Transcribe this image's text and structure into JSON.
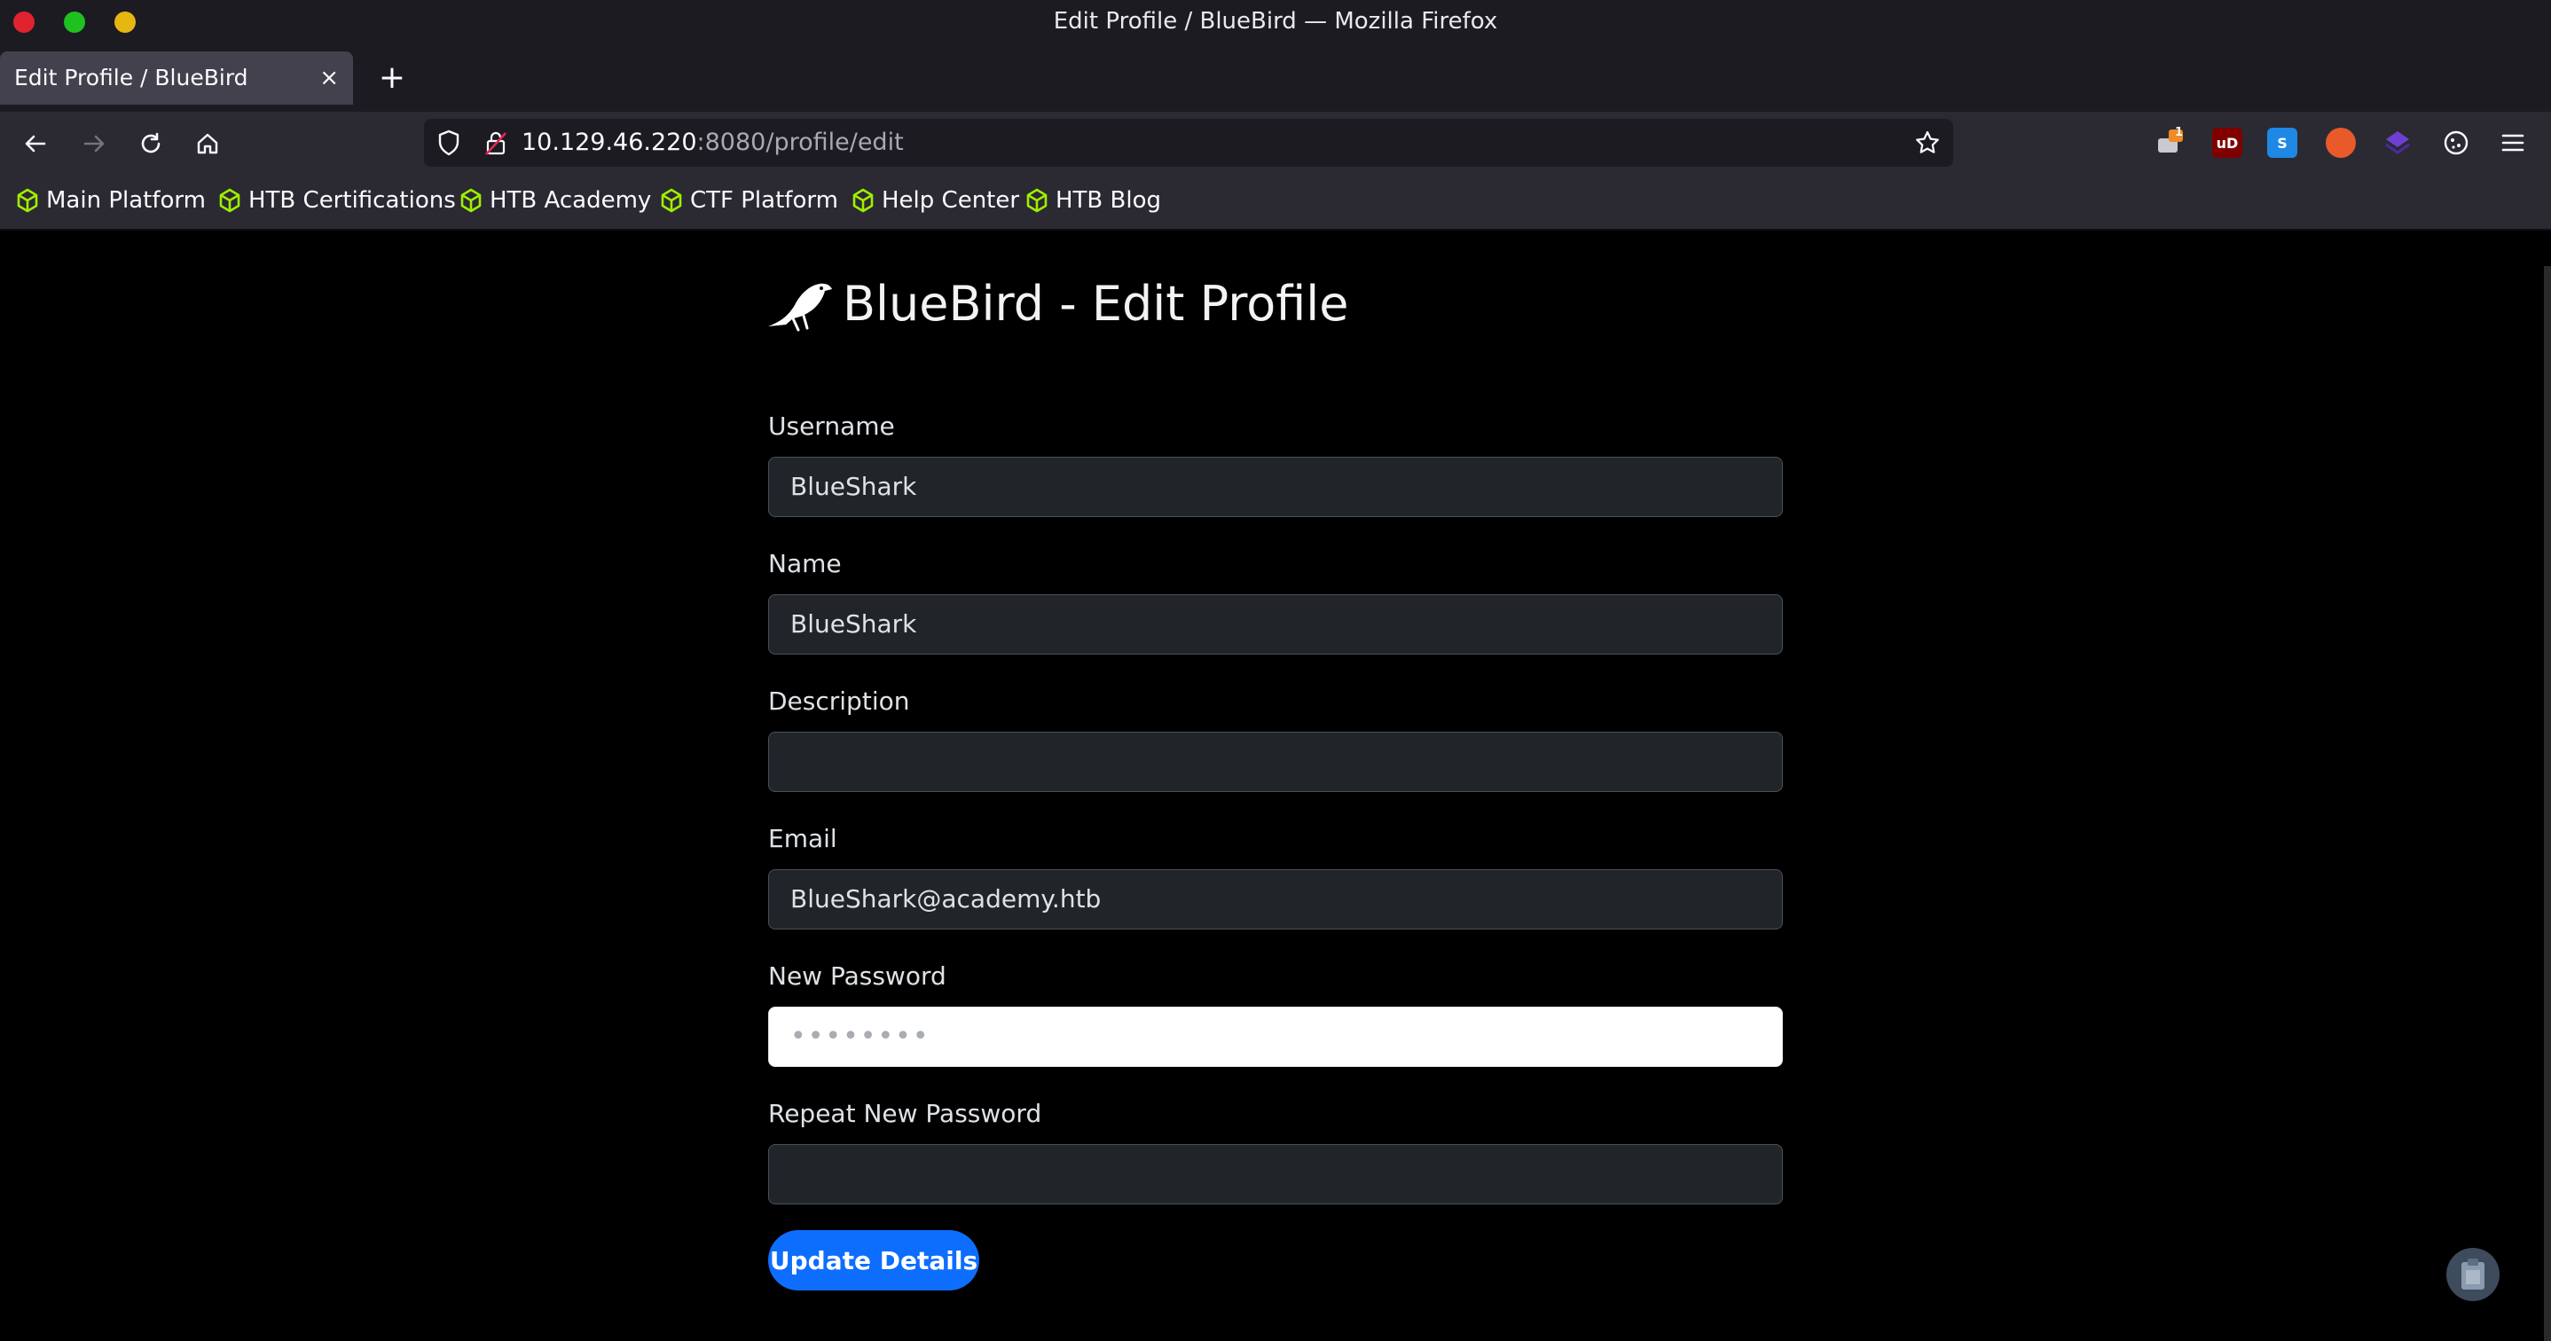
{
  "window": {
    "title": "Edit Profile / BlueBird — Mozilla Firefox"
  },
  "tab": {
    "title": "Edit Profile / BlueBird",
    "close": "×",
    "new_tab": "+"
  },
  "url": {
    "host": "10.129.46.220",
    "rest": ":8080/profile/edit"
  },
  "extensions": [
    {
      "name": "notification-extension-icon",
      "badge": "1"
    },
    {
      "name": "ublock-origin-icon",
      "text": "uD"
    },
    {
      "name": "s-extension-icon",
      "text": "S"
    },
    {
      "name": "foxyproxy-icon"
    },
    {
      "name": "wappalyzer-icon"
    },
    {
      "name": "cookie-editor-icon"
    }
  ],
  "bookmarks": [
    "Main Platform",
    "HTB Certifications",
    "HTB Academy",
    "CTF Platform",
    "Help Center",
    "HTB Blog"
  ],
  "page": {
    "title": "BlueBird - Edit Profile",
    "fields": [
      {
        "label": "Username",
        "value": "BlueShark"
      },
      {
        "label": "Name",
        "value": "BlueShark"
      },
      {
        "label": "Description",
        "value": ""
      },
      {
        "label": "Email",
        "value": "BlueShark@academy.htb"
      },
      {
        "label": "New Password",
        "value": "••••••••"
      },
      {
        "label": "Repeat New Password",
        "value": ""
      }
    ],
    "submit_label": "Update Details"
  },
  "colors": {
    "accent": "#0d6efd",
    "bookmark_icon": "#9fef00",
    "page_bg": "#000000"
  }
}
